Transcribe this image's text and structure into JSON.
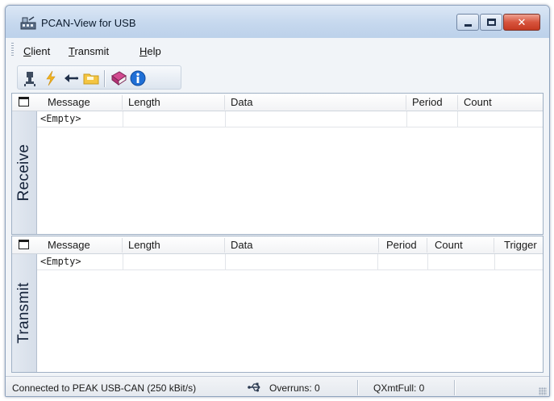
{
  "window": {
    "title": "PCAN-View for USB",
    "app_icon": "pcan-app-icon",
    "controls": {
      "minimize_icon": "minimize-icon",
      "maximize_icon": "maximize-icon",
      "close_icon": "close-icon",
      "close_glyph": "✕"
    }
  },
  "menu": [
    {
      "underline": "C",
      "rest": "lient"
    },
    {
      "underline": "T",
      "rest": "ransmit"
    },
    {
      "underline": "H",
      "rest": "elp"
    }
  ],
  "toolbar": {
    "icons": [
      "connect-icon",
      "disconnect-icon",
      "import-icon",
      "open-folder-icon",
      "manual-icon",
      "about-icon"
    ]
  },
  "receive": {
    "side_label": "Receive",
    "columns": [
      "Message",
      "Length",
      "Data",
      "Period",
      "Count"
    ],
    "rows": [
      {
        "message": "<Empty>"
      }
    ]
  },
  "transmit": {
    "side_label": "Transmit",
    "columns": [
      "Message",
      "Length",
      "Data",
      "Period",
      "Count",
      "Trigger"
    ],
    "rows": [
      {
        "message": "<Empty>"
      }
    ]
  },
  "status": {
    "connection": "Connected to PEAK USB-CAN (250 kBit/s)",
    "connection_icon": "usb-icon",
    "overruns": "Overruns: 0",
    "qxmtfull": "QXmtFull: 0"
  },
  "colors": {
    "titlebar": "#c6d8ee",
    "close_button": "#d7543d",
    "panel_side": "#d6dee9",
    "about_icon": "#1f6fd6",
    "connect_bolt": "#f2b320",
    "folder": "#f4c542"
  }
}
